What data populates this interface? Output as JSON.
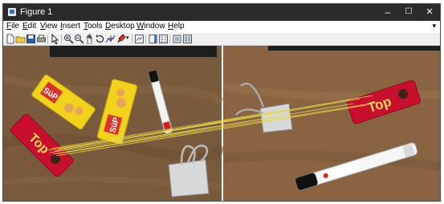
{
  "window": {
    "title": "Figure 1",
    "controls": {
      "minimize": "–",
      "maximize": "☐",
      "close": "✕"
    }
  },
  "menu": {
    "items": [
      {
        "label": "File",
        "hotkey": "F",
        "rest": "ile"
      },
      {
        "label": "Edit",
        "hotkey": "E",
        "rest": "dit"
      },
      {
        "label": "View",
        "hotkey": "V",
        "rest": "iew"
      },
      {
        "label": "Insert",
        "hotkey": "I",
        "rest": "nsert"
      },
      {
        "label": "Tools",
        "hotkey": "T",
        "rest": "ools"
      },
      {
        "label": "Desktop",
        "hotkey": "D",
        "rest": "esktop"
      },
      {
        "label": "Window",
        "hotkey": "W",
        "rest": "indow"
      },
      {
        "label": "Help",
        "hotkey": "H",
        "rest": "elp"
      }
    ],
    "dock_arrow": "▾"
  },
  "toolbar": {
    "tools": [
      "new-figure-icon",
      "open-file-icon",
      "save-icon",
      "print-icon",
      "edit-plot-icon",
      "zoom-in-icon",
      "zoom-out-icon",
      "pan-icon",
      "rotate-3d-icon",
      "data-cursor-icon",
      "brush-icon",
      "link-plot-icon",
      "insert-colorbar-icon",
      "insert-legend-icon",
      "hide-plot-tools-icon",
      "show-plot-tools-icon"
    ]
  },
  "figure": {
    "left_image": {
      "packets": [
        {
          "brand": "SüP",
          "color": "#f2d21a"
        },
        {
          "brand": "SüP",
          "color": "#f2d21a"
        },
        {
          "brand": "SüP",
          "color": "#f2d21a"
        },
        {
          "brand": "Top",
          "color": "#c8102e"
        }
      ]
    },
    "right_image": {
      "packets": [
        {
          "brand": "Top",
          "color": "#c8102e"
        }
      ]
    },
    "match_line_color": "#e6d64a"
  }
}
